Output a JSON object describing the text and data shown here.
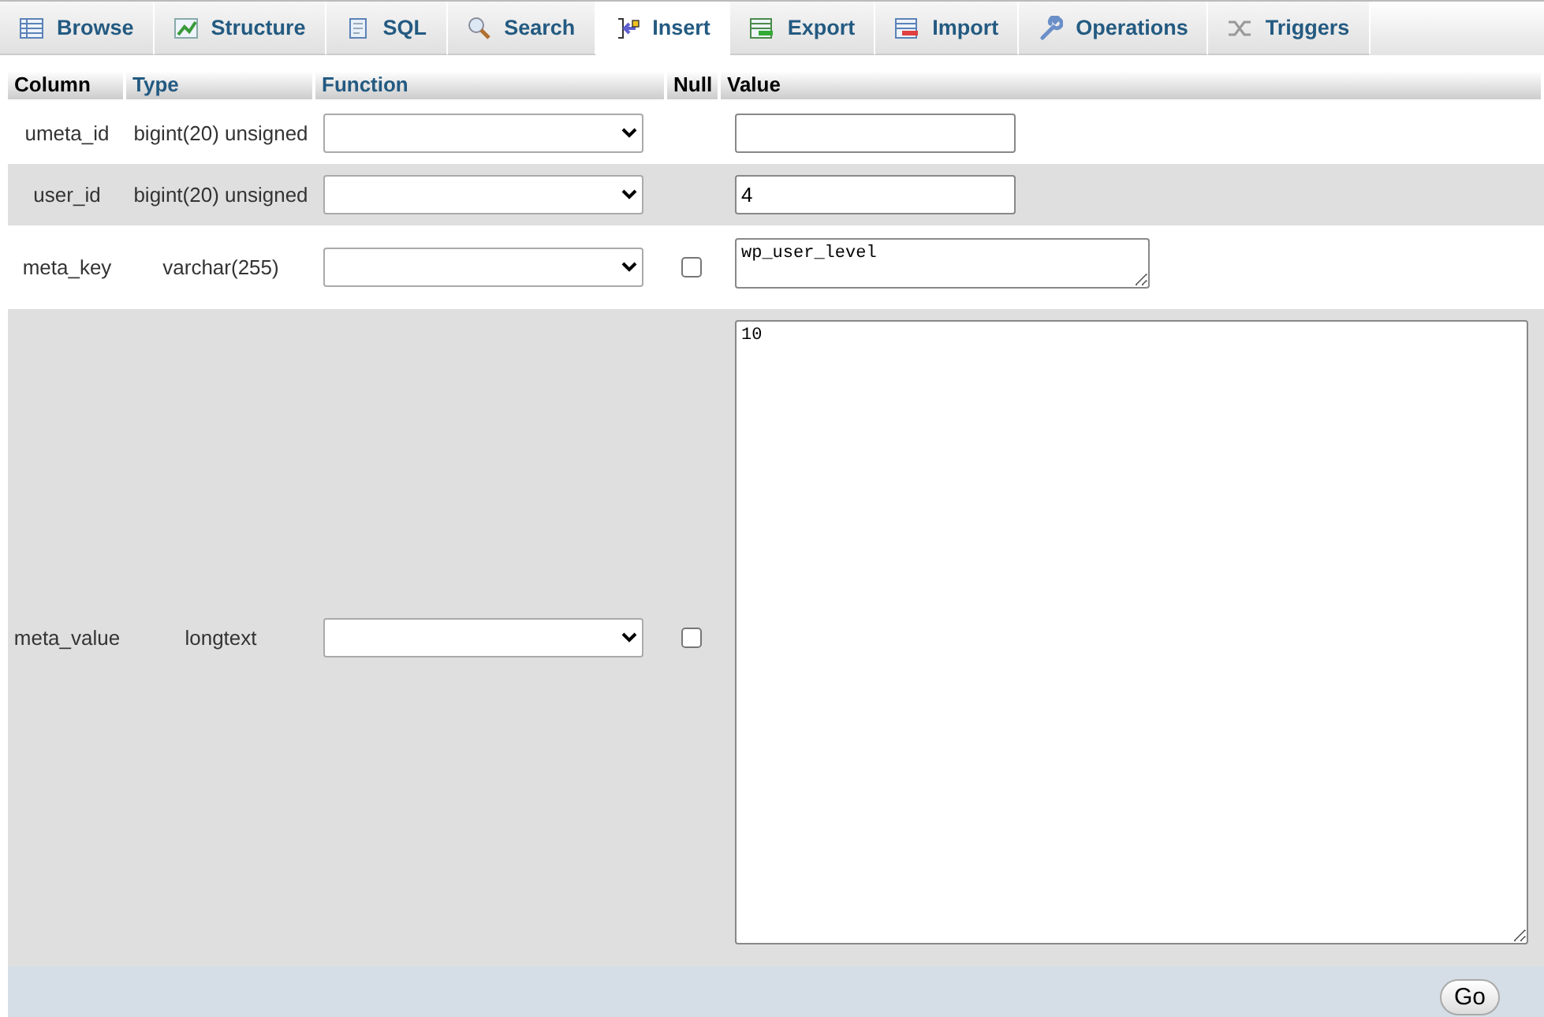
{
  "tabs": [
    {
      "label": "Browse",
      "selected": false
    },
    {
      "label": "Structure",
      "selected": false
    },
    {
      "label": "SQL",
      "selected": false
    },
    {
      "label": "Search",
      "selected": false
    },
    {
      "label": "Insert",
      "selected": true
    },
    {
      "label": "Export",
      "selected": false
    },
    {
      "label": "Import",
      "selected": false
    },
    {
      "label": "Operations",
      "selected": false
    },
    {
      "label": "Triggers",
      "selected": false
    }
  ],
  "table": {
    "columns": [
      "Column",
      "Type",
      "Function",
      "Null",
      "Value"
    ],
    "rows": [
      {
        "column": "umeta_id",
        "type": "bigint(20) unsigned",
        "kind": "input",
        "value": ""
      },
      {
        "column": "user_id",
        "type": "bigint(20) unsigned",
        "kind": "input",
        "value": "4"
      },
      {
        "column": "meta_key",
        "type": "varchar(255)",
        "null_checked": false,
        "kind": "textarea",
        "value": "wp_user_level"
      },
      {
        "column": "meta_value",
        "type": "longtext",
        "null_checked": false,
        "kind": "bigtextarea",
        "value": "10"
      }
    ]
  },
  "go_button": "Go"
}
